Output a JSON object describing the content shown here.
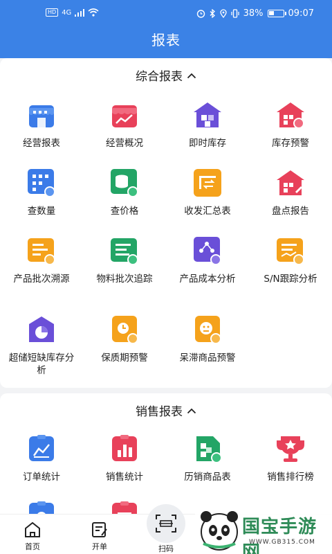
{
  "status_bar": {
    "hd": "HD",
    "network": "4G",
    "battery": "38%",
    "battery_fraction": 0.38,
    "time": "09:07"
  },
  "header": {
    "title": "报表"
  },
  "sections": [
    {
      "title": "综合报表",
      "items": [
        {
          "label": "经营报表",
          "icon": "store-icon"
        },
        {
          "label": "经营概况",
          "icon": "shop-trend-icon"
        },
        {
          "label": "即时库存",
          "icon": "warehouse-cubes-icon"
        },
        {
          "label": "库存预警",
          "icon": "warehouse-alert-icon"
        },
        {
          "label": "查数量",
          "icon": "grid-search-icon"
        },
        {
          "label": "查价格",
          "icon": "coins-search-icon"
        },
        {
          "label": "收发汇总表",
          "icon": "transfer-summary-icon"
        },
        {
          "label": "盘点报告",
          "icon": "inventory-house-icon"
        },
        {
          "label": "产品批次溯源",
          "icon": "batch-trace-icon"
        },
        {
          "label": "物料批次追踪",
          "icon": "material-trace-icon"
        },
        {
          "label": "产品成本分析",
          "icon": "cost-analysis-icon"
        },
        {
          "label": "S/N跟踪分析",
          "icon": "sn-tracking-icon"
        },
        {
          "label": "超储短缺库存分析",
          "icon": "pie-house-icon"
        },
        {
          "label": "保质期预警",
          "icon": "shelf-life-clock-icon"
        },
        {
          "label": "呆滞商品预警",
          "icon": "stale-goods-face-icon"
        }
      ]
    },
    {
      "title": "销售报表",
      "items": [
        {
          "label": "订单统计",
          "icon": "order-chart-icon"
        },
        {
          "label": "销售统计",
          "icon": "sales-bar-icon"
        },
        {
          "label": "历销商品表",
          "icon": "history-goods-icon"
        },
        {
          "label": "销售排行榜",
          "icon": "trophy-icon"
        }
      ]
    }
  ],
  "tabbar": {
    "home": "首页",
    "open_order": "开单",
    "scan": "扫码"
  },
  "watermark": {
    "brand": "国宝手游网",
    "url": "WWW.GB315.COM"
  },
  "colors": {
    "primary": "#3b82e6",
    "red": "#e8415a",
    "green": "#23a566",
    "orange": "#f5a21b",
    "purple": "#6a4fd8",
    "blue": "#3b7be8"
  }
}
